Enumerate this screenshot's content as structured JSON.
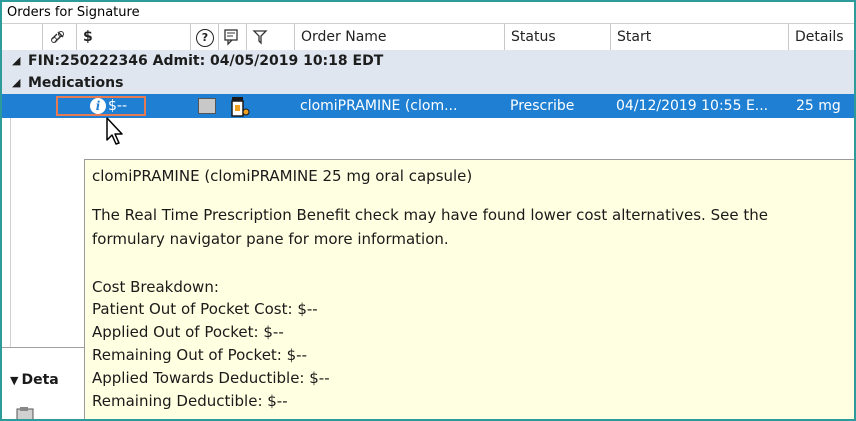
{
  "window": {
    "title": "Orders for Signature"
  },
  "columns": {
    "dollar": "$",
    "question": "?",
    "order_name": "Order Name",
    "status": "Status",
    "start": "Start",
    "details": "Details"
  },
  "groups": {
    "fin": "FIN:250222346  Admit: 04/05/2019 10:18 EDT",
    "medications": "Medications"
  },
  "selected_order": {
    "cost": "$--",
    "order_name": "clomiPRAMINE (clom...",
    "status": "Prescribe",
    "start": "04/12/2019 10:55 E...",
    "details": "25 mg"
  },
  "tooltip": {
    "title": "clomiPRAMINE (clomiPRAMINE 25 mg oral capsule)",
    "message_line1": "The Real Time Prescription Benefit check may have found lower cost alternatives. See the",
    "message_line2": "formulary navigator pane for more information.",
    "cost_header": "Cost Breakdown:",
    "lines": [
      "Patient Out of Pocket Cost: $--",
      "Applied Out of Pocket: $--",
      "Remaining Out of Pocket: $--",
      "Applied Towards Deductible: $--",
      "Remaining Deductible: $--"
    ]
  },
  "details_panel": {
    "label": "Deta"
  },
  "colors": {
    "accent_border": "#2e9b9b",
    "selection": "#1e7fd3",
    "group_background": "#dfe6ef",
    "tooltip_background": "#ffffe1",
    "highlight_box": "#e87a52"
  },
  "icons": {
    "header": [
      "link-chain-icon",
      "dollar-icon",
      "question-circle-icon",
      "note-icon",
      "flag-icon"
    ],
    "row": [
      "info-icon",
      "checkbox-icon",
      "pill-bottle-icon",
      "mouse-cursor-icon"
    ]
  }
}
